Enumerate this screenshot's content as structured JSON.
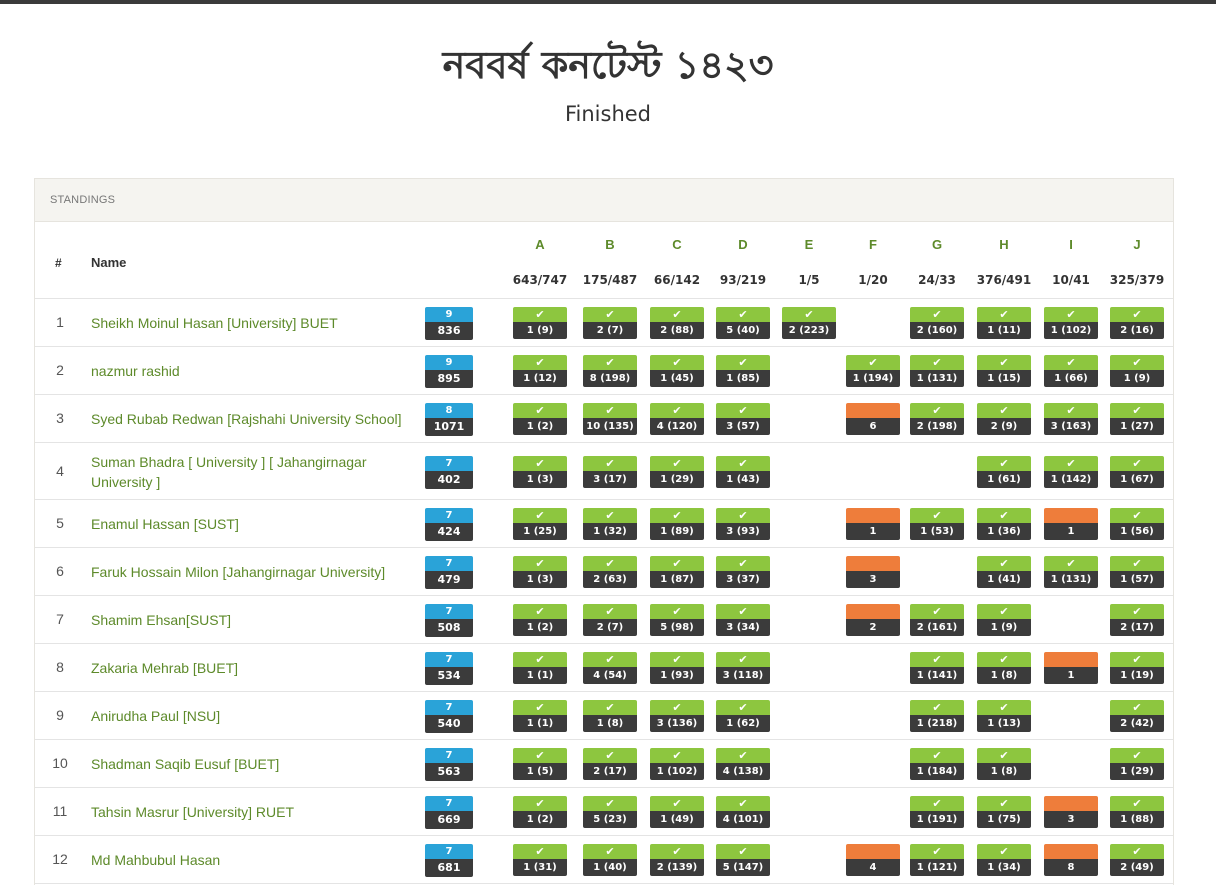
{
  "contest": {
    "title": "নববর্ষ কনটেস্ট ১৪২৩",
    "status": "Finished"
  },
  "standings": {
    "panel_title": "STANDINGS",
    "columns": {
      "rank": "#",
      "name": "Name"
    },
    "problems": [
      {
        "letter": "A",
        "ratio": "643/747"
      },
      {
        "letter": "B",
        "ratio": "175/487"
      },
      {
        "letter": "C",
        "ratio": "66/142"
      },
      {
        "letter": "D",
        "ratio": "93/219"
      },
      {
        "letter": "E",
        "ratio": "1/5"
      },
      {
        "letter": "F",
        "ratio": "1/20"
      },
      {
        "letter": "G",
        "ratio": "24/33"
      },
      {
        "letter": "H",
        "ratio": "376/491"
      },
      {
        "letter": "I",
        "ratio": "10/41"
      },
      {
        "letter": "J",
        "ratio": "325/379"
      }
    ],
    "accepted_mark": "✔",
    "colors": {
      "accepted": "#8dc63f",
      "rejected": "#ee7d3b",
      "solved_badge": "#2aa3d8",
      "name_link": "#5d8a2a"
    },
    "rows": [
      {
        "rank": "1",
        "name": "Sheikh Moinul Hasan [University] BUET",
        "solved": "9",
        "penalty": "836",
        "cells": [
          {
            "s": "ac",
            "t": "1 (9)"
          },
          {
            "s": "ac",
            "t": "2 (7)"
          },
          {
            "s": "ac",
            "t": "2 (88)"
          },
          {
            "s": "ac",
            "t": "5 (40)"
          },
          {
            "s": "ac",
            "t": "2 (223)"
          },
          null,
          {
            "s": "ac",
            "t": "2 (160)"
          },
          {
            "s": "ac",
            "t": "1 (11)"
          },
          {
            "s": "ac",
            "t": "1 (102)"
          },
          {
            "s": "ac",
            "t": "2 (16)"
          }
        ]
      },
      {
        "rank": "2",
        "name": "nazmur rashid",
        "solved": "9",
        "penalty": "895",
        "cells": [
          {
            "s": "ac",
            "t": "1 (12)"
          },
          {
            "s": "ac",
            "t": "8 (198)"
          },
          {
            "s": "ac",
            "t": "1 (45)"
          },
          {
            "s": "ac",
            "t": "1 (85)"
          },
          null,
          {
            "s": "ac",
            "t": "1 (194)"
          },
          {
            "s": "ac",
            "t": "1 (131)"
          },
          {
            "s": "ac",
            "t": "1 (15)"
          },
          {
            "s": "ac",
            "t": "1 (66)"
          },
          {
            "s": "ac",
            "t": "1 (9)"
          }
        ]
      },
      {
        "rank": "3",
        "name": "Syed Rubab Redwan [Rajshahi University School]",
        "solved": "8",
        "penalty": "1071",
        "cells": [
          {
            "s": "ac",
            "t": "1 (2)"
          },
          {
            "s": "ac",
            "t": "10 (135)"
          },
          {
            "s": "ac",
            "t": "4 (120)"
          },
          {
            "s": "ac",
            "t": "3 (57)"
          },
          null,
          {
            "s": "wa",
            "t": "6"
          },
          {
            "s": "ac",
            "t": "2 (198)"
          },
          {
            "s": "ac",
            "t": "2 (9)"
          },
          {
            "s": "ac",
            "t": "3 (163)"
          },
          {
            "s": "ac",
            "t": "1 (27)"
          }
        ]
      },
      {
        "rank": "4",
        "name": "Suman Bhadra [ University ] [ Jahangirnagar University ]",
        "solved": "7",
        "penalty": "402",
        "cells": [
          {
            "s": "ac",
            "t": "1 (3)"
          },
          {
            "s": "ac",
            "t": "3 (17)"
          },
          {
            "s": "ac",
            "t": "1 (29)"
          },
          {
            "s": "ac",
            "t": "1 (43)"
          },
          null,
          null,
          null,
          {
            "s": "ac",
            "t": "1 (61)"
          },
          {
            "s": "ac",
            "t": "1 (142)"
          },
          {
            "s": "ac",
            "t": "1 (67)"
          }
        ]
      },
      {
        "rank": "5",
        "name": "Enamul Hassan [SUST]",
        "solved": "7",
        "penalty": "424",
        "cells": [
          {
            "s": "ac",
            "t": "1 (25)"
          },
          {
            "s": "ac",
            "t": "1 (32)"
          },
          {
            "s": "ac",
            "t": "1 (89)"
          },
          {
            "s": "ac",
            "t": "3 (93)"
          },
          null,
          {
            "s": "wa",
            "t": "1"
          },
          {
            "s": "ac",
            "t": "1 (53)"
          },
          {
            "s": "ac",
            "t": "1 (36)"
          },
          {
            "s": "wa",
            "t": "1"
          },
          {
            "s": "ac",
            "t": "1 (56)"
          }
        ]
      },
      {
        "rank": "6",
        "name": "Faruk Hossain Milon [Jahangirnagar University]",
        "solved": "7",
        "penalty": "479",
        "cells": [
          {
            "s": "ac",
            "t": "1 (3)"
          },
          {
            "s": "ac",
            "t": "2 (63)"
          },
          {
            "s": "ac",
            "t": "1 (87)"
          },
          {
            "s": "ac",
            "t": "3 (37)"
          },
          null,
          {
            "s": "wa",
            "t": "3"
          },
          null,
          {
            "s": "ac",
            "t": "1 (41)"
          },
          {
            "s": "ac",
            "t": "1 (131)"
          },
          {
            "s": "ac",
            "t": "1 (57)"
          }
        ]
      },
      {
        "rank": "7",
        "name": "Shamim Ehsan[SUST]",
        "solved": "7",
        "penalty": "508",
        "cells": [
          {
            "s": "ac",
            "t": "1 (2)"
          },
          {
            "s": "ac",
            "t": "2 (7)"
          },
          {
            "s": "ac",
            "t": "5 (98)"
          },
          {
            "s": "ac",
            "t": "3 (34)"
          },
          null,
          {
            "s": "wa",
            "t": "2"
          },
          {
            "s": "ac",
            "t": "2 (161)"
          },
          {
            "s": "ac",
            "t": "1 (9)"
          },
          null,
          {
            "s": "ac",
            "t": "2 (17)"
          }
        ]
      },
      {
        "rank": "8",
        "name": "Zakaria Mehrab [BUET]",
        "solved": "7",
        "penalty": "534",
        "cells": [
          {
            "s": "ac",
            "t": "1 (1)"
          },
          {
            "s": "ac",
            "t": "4 (54)"
          },
          {
            "s": "ac",
            "t": "1 (93)"
          },
          {
            "s": "ac",
            "t": "3 (118)"
          },
          null,
          null,
          {
            "s": "ac",
            "t": "1 (141)"
          },
          {
            "s": "ac",
            "t": "1 (8)"
          },
          {
            "s": "wa",
            "t": "1"
          },
          {
            "s": "ac",
            "t": "1 (19)"
          }
        ]
      },
      {
        "rank": "9",
        "name": "Anirudha Paul [NSU]",
        "solved": "7",
        "penalty": "540",
        "cells": [
          {
            "s": "ac",
            "t": "1 (1)"
          },
          {
            "s": "ac",
            "t": "1 (8)"
          },
          {
            "s": "ac",
            "t": "3 (136)"
          },
          {
            "s": "ac",
            "t": "1 (62)"
          },
          null,
          null,
          {
            "s": "ac",
            "t": "1 (218)"
          },
          {
            "s": "ac",
            "t": "1 (13)"
          },
          null,
          {
            "s": "ac",
            "t": "2 (42)"
          }
        ]
      },
      {
        "rank": "10",
        "name": "Shadman Saqib Eusuf [BUET]",
        "solved": "7",
        "penalty": "563",
        "cells": [
          {
            "s": "ac",
            "t": "1 (5)"
          },
          {
            "s": "ac",
            "t": "2 (17)"
          },
          {
            "s": "ac",
            "t": "1 (102)"
          },
          {
            "s": "ac",
            "t": "4 (138)"
          },
          null,
          null,
          {
            "s": "ac",
            "t": "1 (184)"
          },
          {
            "s": "ac",
            "t": "1 (8)"
          },
          null,
          {
            "s": "ac",
            "t": "1 (29)"
          }
        ]
      },
      {
        "rank": "11",
        "name": "Tahsin Masrur [University] RUET",
        "solved": "7",
        "penalty": "669",
        "cells": [
          {
            "s": "ac",
            "t": "1 (2)"
          },
          {
            "s": "ac",
            "t": "5 (23)"
          },
          {
            "s": "ac",
            "t": "1 (49)"
          },
          {
            "s": "ac",
            "t": "4 (101)"
          },
          null,
          null,
          {
            "s": "ac",
            "t": "1 (191)"
          },
          {
            "s": "ac",
            "t": "1 (75)"
          },
          {
            "s": "wa",
            "t": "3"
          },
          {
            "s": "ac",
            "t": "1 (88)"
          }
        ]
      },
      {
        "rank": "12",
        "name": "Md Mahbubul Hasan",
        "solved": "7",
        "penalty": "681",
        "cells": [
          {
            "s": "ac",
            "t": "1 (31)"
          },
          {
            "s": "ac",
            "t": "1 (40)"
          },
          {
            "s": "ac",
            "t": "2 (139)"
          },
          {
            "s": "ac",
            "t": "5 (147)"
          },
          null,
          {
            "s": "wa",
            "t": "4"
          },
          {
            "s": "ac",
            "t": "1 (121)"
          },
          {
            "s": "ac",
            "t": "1 (34)"
          },
          {
            "s": "wa",
            "t": "8"
          },
          {
            "s": "ac",
            "t": "2 (49)"
          }
        ]
      }
    ]
  }
}
